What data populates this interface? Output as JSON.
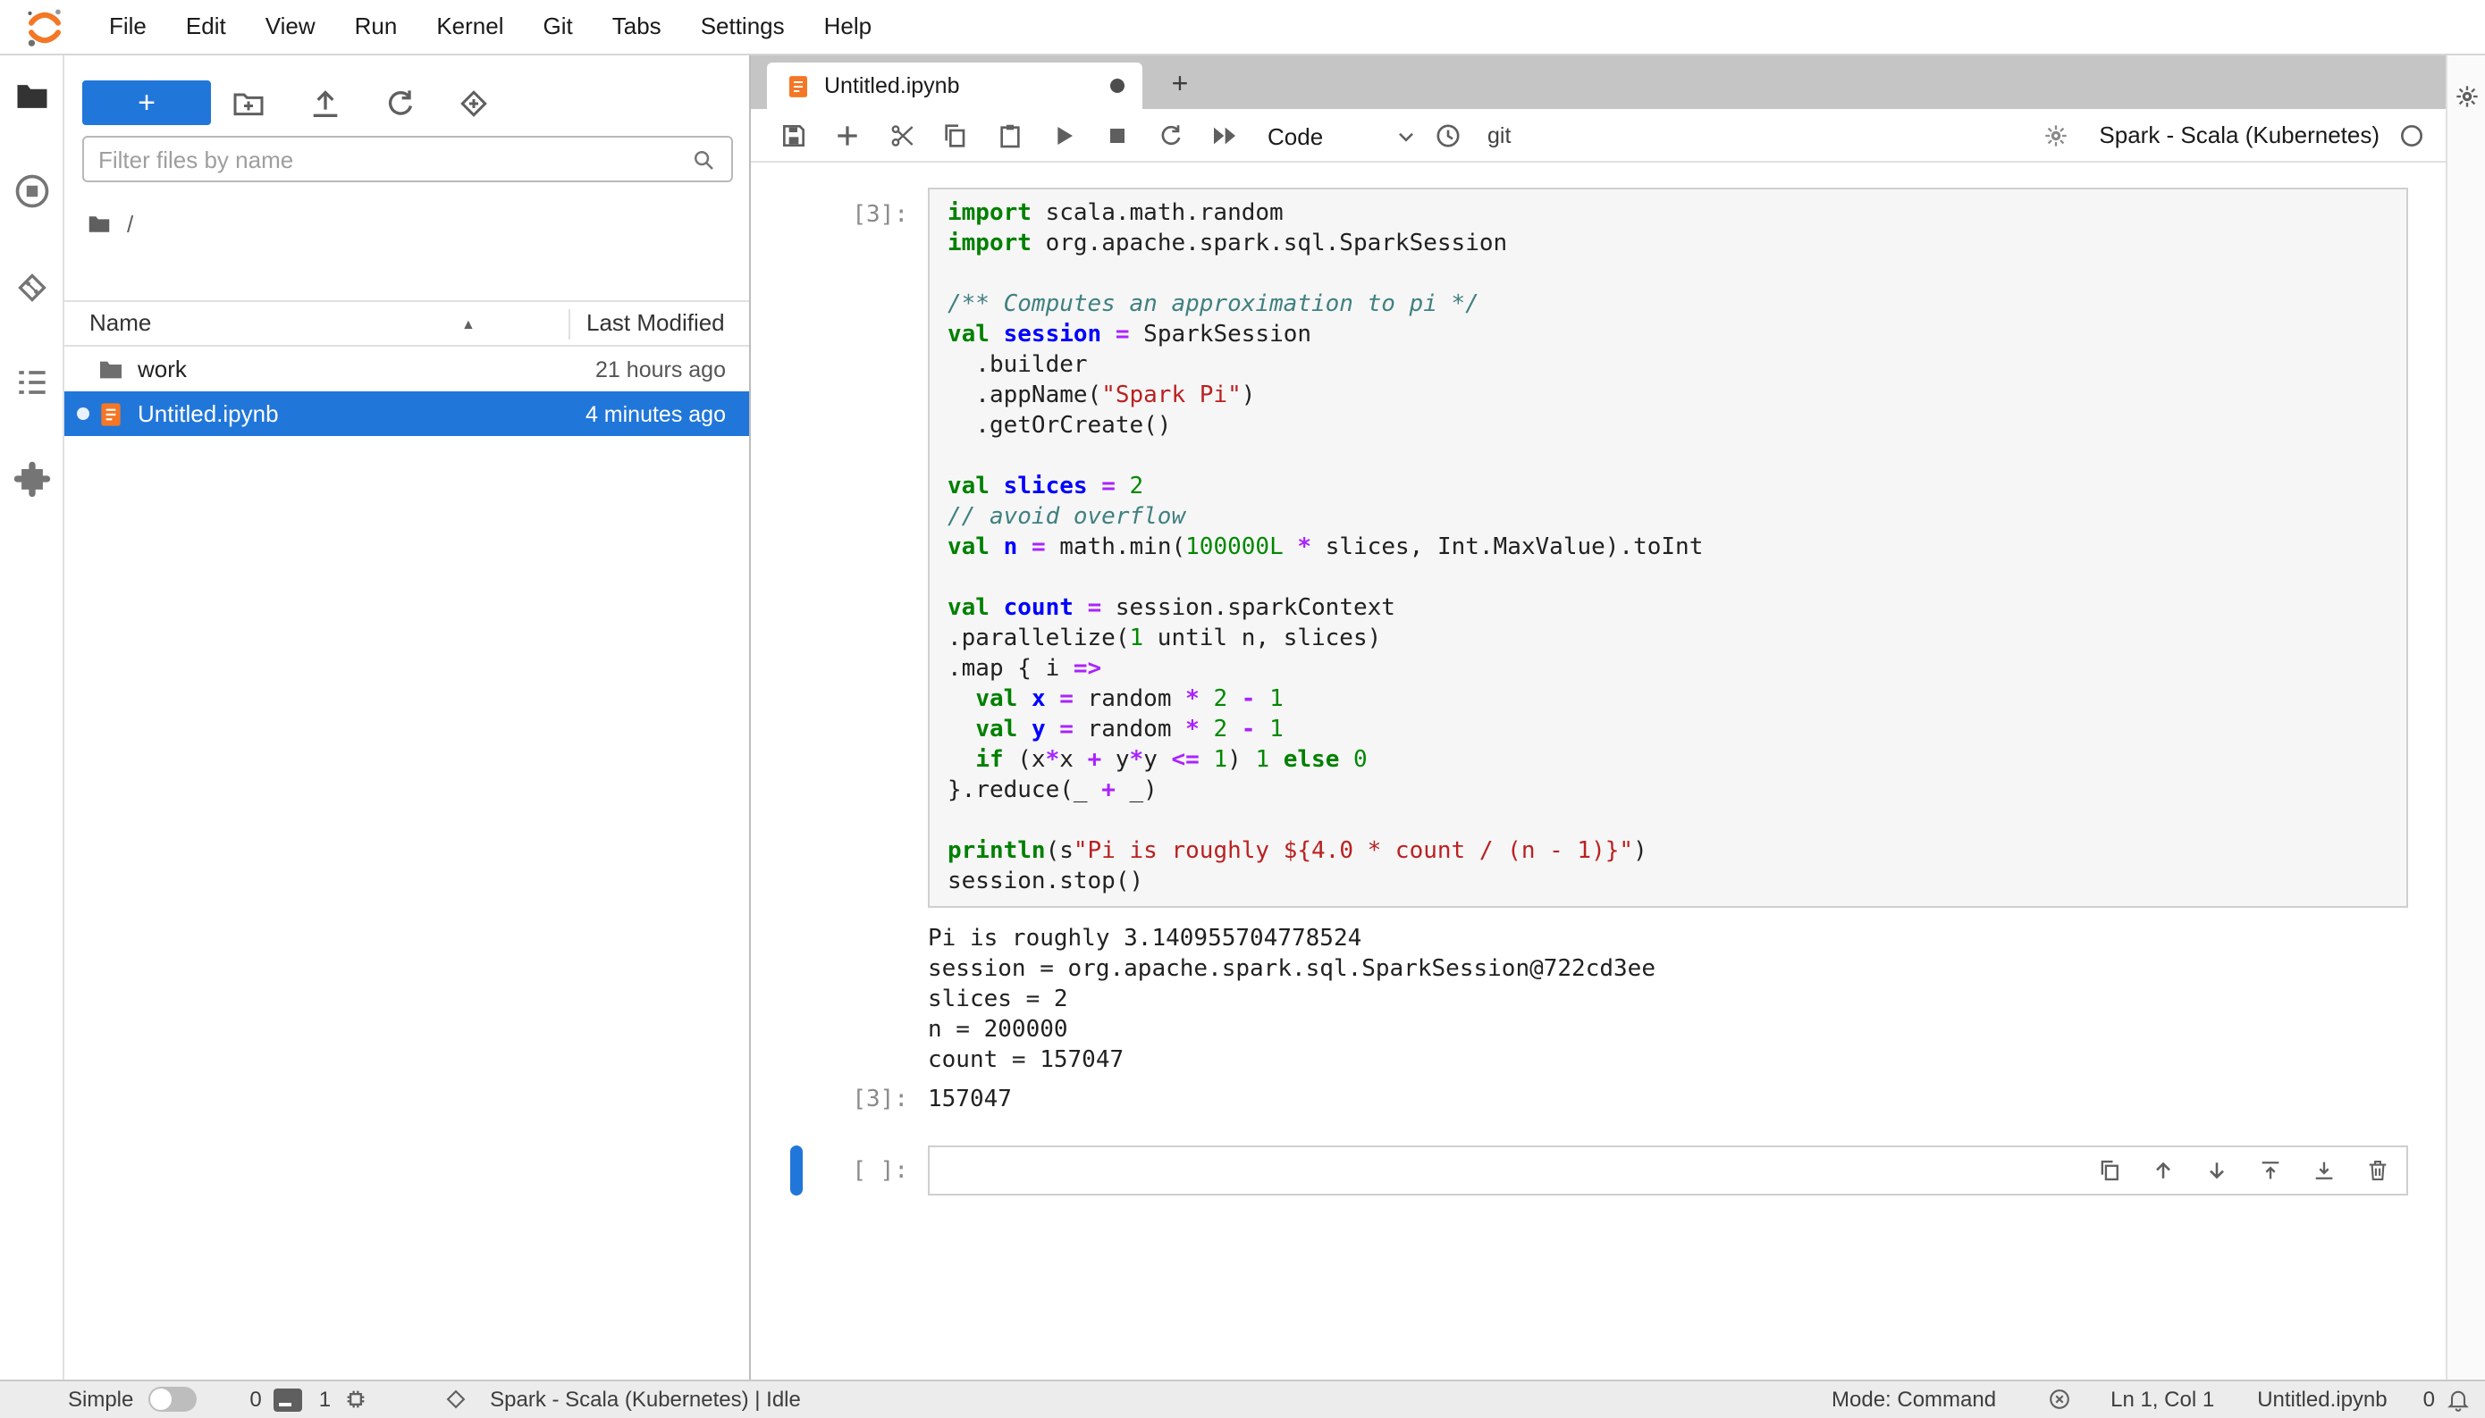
{
  "menubar": {
    "items": [
      {
        "label": "File"
      },
      {
        "label": "Edit"
      },
      {
        "label": "View"
      },
      {
        "label": "Run"
      },
      {
        "label": "Kernel"
      },
      {
        "label": "Git"
      },
      {
        "label": "Tabs"
      },
      {
        "label": "Settings"
      },
      {
        "label": "Help"
      }
    ]
  },
  "sidebar": {
    "tabs": [
      "file-browser",
      "running-terminals-and-kernels",
      "git",
      "table-of-contents",
      "extension-manager"
    ]
  },
  "filebrowser": {
    "new_launcher_label": "+",
    "filter_placeholder": "Filter files by name",
    "breadcrumb_root": "/",
    "columns": {
      "name": "Name",
      "modified": "Last Modified"
    },
    "rows": [
      {
        "name": "work",
        "modified": "21 hours ago",
        "type": "folder",
        "selected": false
      },
      {
        "name": "Untitled.ipynb",
        "modified": "4 minutes ago",
        "type": "notebook",
        "selected": true
      }
    ]
  },
  "tabbar": {
    "add_label": "+",
    "tabs": [
      {
        "title": "Untitled.ipynb",
        "dirty": true
      }
    ]
  },
  "toolbar": {
    "celltype": "Code",
    "git_label": "git",
    "kernel_name": "Spark - Scala (Kubernetes)",
    "kernel_status": "idle"
  },
  "notebook": {
    "cells": [
      {
        "prompt": "[3]:",
        "code_tokens": [
          [
            [
              "k",
              "import"
            ],
            [
              "t",
              " scala.math.random"
            ]
          ],
          [
            [
              "k",
              "import"
            ],
            [
              "t",
              " org.apache.spark.sql.SparkSession"
            ]
          ],
          [],
          [
            [
              "c",
              "/** Computes an approximation to pi */"
            ]
          ],
          [
            [
              "k",
              "val"
            ],
            [
              "t",
              " "
            ],
            [
              "d",
              "session"
            ],
            [
              "t",
              " "
            ],
            [
              "o",
              "="
            ],
            [
              "t",
              " SparkSession"
            ]
          ],
          [
            [
              "t",
              "  .builder"
            ]
          ],
          [
            [
              "t",
              "  .appName("
            ],
            [
              "s",
              "\"Spark Pi\""
            ],
            [
              "t",
              ")"
            ]
          ],
          [
            [
              "t",
              "  .getOrCreate()"
            ]
          ],
          [],
          [
            [
              "k",
              "val"
            ],
            [
              "t",
              " "
            ],
            [
              "d",
              "slices"
            ],
            [
              "t",
              " "
            ],
            [
              "o",
              "="
            ],
            [
              "t",
              " "
            ],
            [
              "n",
              "2"
            ]
          ],
          [
            [
              "c",
              "// avoid overflow"
            ]
          ],
          [
            [
              "k",
              "val"
            ],
            [
              "t",
              " "
            ],
            [
              "d",
              "n"
            ],
            [
              "t",
              " "
            ],
            [
              "o",
              "="
            ],
            [
              "t",
              " math.min("
            ],
            [
              "n",
              "100000L"
            ],
            [
              "t",
              " "
            ],
            [
              "o",
              "*"
            ],
            [
              "t",
              " slices, Int.MaxValue).toInt"
            ]
          ],
          [],
          [
            [
              "k",
              "val"
            ],
            [
              "t",
              " "
            ],
            [
              "d",
              "count"
            ],
            [
              "t",
              " "
            ],
            [
              "o",
              "="
            ],
            [
              "t",
              " session.sparkContext"
            ]
          ],
          [
            [
              "t",
              ".parallelize("
            ],
            [
              "n",
              "1"
            ],
            [
              "t",
              " until n, slices)"
            ]
          ],
          [
            [
              "t",
              ".map { i "
            ],
            [
              "o",
              "=>"
            ]
          ],
          [
            [
              "t",
              "  "
            ],
            [
              "k",
              "val"
            ],
            [
              "t",
              " "
            ],
            [
              "d",
              "x"
            ],
            [
              "t",
              " "
            ],
            [
              "o",
              "="
            ],
            [
              "t",
              " random "
            ],
            [
              "o",
              "*"
            ],
            [
              "t",
              " "
            ],
            [
              "n",
              "2"
            ],
            [
              "t",
              " "
            ],
            [
              "o",
              "-"
            ],
            [
              "t",
              " "
            ],
            [
              "n",
              "1"
            ]
          ],
          [
            [
              "t",
              "  "
            ],
            [
              "k",
              "val"
            ],
            [
              "t",
              " "
            ],
            [
              "d",
              "y"
            ],
            [
              "t",
              " "
            ],
            [
              "o",
              "="
            ],
            [
              "t",
              " random "
            ],
            [
              "o",
              "*"
            ],
            [
              "t",
              " "
            ],
            [
              "n",
              "2"
            ],
            [
              "t",
              " "
            ],
            [
              "o",
              "-"
            ],
            [
              "t",
              " "
            ],
            [
              "n",
              "1"
            ]
          ],
          [
            [
              "t",
              "  "
            ],
            [
              "k",
              "if"
            ],
            [
              "t",
              " (x"
            ],
            [
              "o",
              "*"
            ],
            [
              "t",
              "x "
            ],
            [
              "o",
              "+"
            ],
            [
              "t",
              " y"
            ],
            [
              "o",
              "*"
            ],
            [
              "t",
              "y "
            ],
            [
              "o",
              "<="
            ],
            [
              "t",
              " "
            ],
            [
              "n",
              "1"
            ],
            [
              "t",
              ") "
            ],
            [
              "n",
              "1"
            ],
            [
              "t",
              " "
            ],
            [
              "k",
              "else"
            ],
            [
              "t",
              " "
            ],
            [
              "n",
              "0"
            ]
          ],
          [
            [
              "t",
              "}.reduce(_ "
            ],
            [
              "o",
              "+"
            ],
            [
              "t",
              " _)"
            ]
          ],
          [],
          [
            [
              "k",
              "println"
            ],
            [
              "t",
              "(s"
            ],
            [
              "s",
              "\"Pi is roughly ${4.0 * count / (n - 1)}\""
            ],
            [
              "t",
              ")"
            ]
          ],
          [
            [
              "t",
              "session.stop()"
            ]
          ]
        ],
        "outputs": [
          "Pi is roughly 3.140955704778524",
          "session = org.apache.spark.sql.SparkSession@722cd3ee",
          "slices = 2",
          "n = 200000",
          "count = 157047"
        ],
        "result_prompt": "[3]:",
        "result": "157047"
      },
      {
        "prompt": "[ ]:",
        "code_tokens": [],
        "outputs": []
      }
    ]
  },
  "statusbar": {
    "simple_label": "Simple",
    "terminals_count": "0",
    "kernels_count": "1",
    "kernel_status": "Spark - Scala (Kubernetes) | Idle",
    "mode": "Mode: Command",
    "position": "Ln 1, Col 1",
    "filename": "Untitled.ipynb",
    "notifications": "0"
  },
  "icons": [
    "jupyter-logo",
    "folder-icon",
    "running-icon",
    "git-icon",
    "toc-icon",
    "extensions-icon",
    "new-folder-icon",
    "upload-icon",
    "refresh-icon",
    "git-clone-icon",
    "search-icon",
    "sort-ascending-icon",
    "notebook-icon",
    "save-icon",
    "add-cell-icon",
    "cut-icon",
    "copy-icon",
    "paste-icon",
    "run-icon",
    "stop-icon",
    "restart-icon",
    "restart-run-all-icon",
    "chevron-down-icon",
    "history-icon",
    "gear-icon",
    "kernel-idle-icon",
    "duplicate-cell-icon",
    "move-cell-up-icon",
    "move-cell-down-icon",
    "insert-cell-above-icon",
    "insert-cell-below-icon",
    "delete-cell-icon",
    "terminal-icon",
    "kernels-icon",
    "status-diamond-icon",
    "connection-status-icon",
    "bell-icon"
  ],
  "colors": {
    "accent": "#2176d9",
    "brand_orange": "#f37726",
    "tab_strip": "#c5c5c5",
    "keyword": "#008000",
    "definition": "#0000ff",
    "operator": "#aa22ff",
    "number": "#008800",
    "string": "#ba2121",
    "comment": "#408080"
  }
}
